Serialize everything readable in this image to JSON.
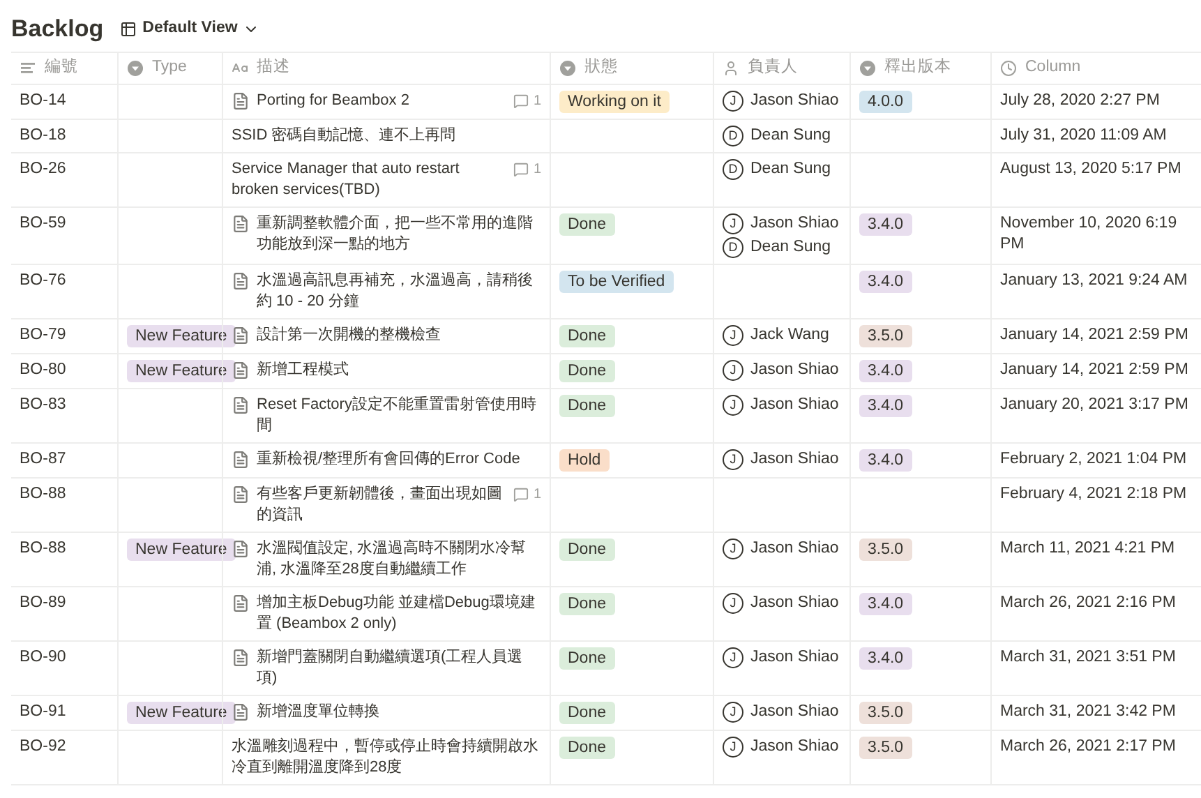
{
  "title": "Backlog",
  "view": {
    "label": "Default View"
  },
  "columns": [
    {
      "label": "編號",
      "kind": "text"
    },
    {
      "label": "Type",
      "kind": "select"
    },
    {
      "label": "描述",
      "kind": "title"
    },
    {
      "label": "狀態",
      "kind": "select"
    },
    {
      "label": "負責人",
      "kind": "person"
    },
    {
      "label": "釋出版本",
      "kind": "select"
    },
    {
      "label": "Column",
      "kind": "date"
    }
  ],
  "rows": [
    {
      "id": "BO-14",
      "type": null,
      "title": "Porting for Beambox 2",
      "page": true,
      "comments": "1",
      "status": {
        "label": "Working on it",
        "color": "#fdecc8"
      },
      "assignees": [
        {
          "initial": "J",
          "name": "Jason Shiao"
        }
      ],
      "version": {
        "label": "4.0.0",
        "color": "#d3e5ef"
      },
      "date": "July 28, 2020 2:27 PM"
    },
    {
      "id": "BO-18",
      "type": null,
      "title": "SSID 密碼自動記憶、連不上再問",
      "page": false,
      "comments": null,
      "status": null,
      "assignees": [
        {
          "initial": "D",
          "name": "Dean Sung"
        }
      ],
      "version": null,
      "date": "July 31, 2020 11:09 AM"
    },
    {
      "id": "BO-26",
      "type": null,
      "title": "Service Manager that auto restart broken services(TBD)",
      "page": false,
      "comments": "1",
      "status": null,
      "assignees": [
        {
          "initial": "D",
          "name": "Dean Sung"
        }
      ],
      "version": null,
      "date": "August 13, 2020 5:17 PM"
    },
    {
      "id": "BO-59",
      "type": null,
      "title": "重新調整軟體介面，把一些不常用的進階功能放到深一點的地方",
      "page": true,
      "comments": null,
      "status": {
        "label": "Done",
        "color": "#dbeddb"
      },
      "assignees": [
        {
          "initial": "J",
          "name": "Jason Shiao"
        },
        {
          "initial": "D",
          "name": "Dean Sung"
        }
      ],
      "version": {
        "label": "3.4.0",
        "color": "#e8deee"
      },
      "date": "November 10, 2020 6:19 PM"
    },
    {
      "id": "BO-76",
      "type": null,
      "title": "水溫過高訊息再補充，水溫過高，請稍後約 10 - 20 分鐘",
      "page": true,
      "comments": null,
      "status": {
        "label": "To be Verified",
        "color": "#d3e5ef"
      },
      "assignees": [],
      "version": {
        "label": "3.4.0",
        "color": "#e8deee"
      },
      "date": "January 13, 2021 9:24 AM"
    },
    {
      "id": "BO-79",
      "type": {
        "label": "New Feature",
        "color": "#e8deee"
      },
      "title": "設計第一次開機的整機檢查",
      "page": true,
      "comments": null,
      "status": {
        "label": "Done",
        "color": "#dbeddb"
      },
      "assignees": [
        {
          "initial": "J",
          "name": "Jack Wang"
        }
      ],
      "version": {
        "label": "3.5.0",
        "color": "#eee0da"
      },
      "date": "January 14, 2021 2:59 PM"
    },
    {
      "id": "BO-80",
      "type": {
        "label": "New Feature",
        "color": "#e8deee"
      },
      "title": "新增工程模式",
      "page": true,
      "comments": null,
      "status": {
        "label": "Done",
        "color": "#dbeddb"
      },
      "assignees": [
        {
          "initial": "J",
          "name": "Jason Shiao"
        }
      ],
      "version": {
        "label": "3.4.0",
        "color": "#e8deee"
      },
      "date": "January 14, 2021 2:59 PM"
    },
    {
      "id": "BO-83",
      "type": null,
      "title": "Reset Factory設定不能重置雷射管使用時間",
      "page": true,
      "comments": null,
      "status": {
        "label": "Done",
        "color": "#dbeddb"
      },
      "assignees": [
        {
          "initial": "J",
          "name": "Jason Shiao"
        }
      ],
      "version": {
        "label": "3.4.0",
        "color": "#e8deee"
      },
      "date": "January 20, 2021 3:17 PM"
    },
    {
      "id": "BO-87",
      "type": null,
      "title": "重新檢視/整理所有會回傳的Error Code",
      "page": true,
      "comments": null,
      "status": {
        "label": "Hold",
        "color": "#fadec9"
      },
      "assignees": [
        {
          "initial": "J",
          "name": "Jason Shiao"
        }
      ],
      "version": {
        "label": "3.4.0",
        "color": "#e8deee"
      },
      "date": "February 2, 2021 1:04 PM"
    },
    {
      "id": "BO-88",
      "type": null,
      "title": "有些客戶更新韌體後，畫面出現如圖的資訊",
      "page": true,
      "comments": "1",
      "status": null,
      "assignees": [],
      "version": null,
      "date": "February 4, 2021 2:18 PM"
    },
    {
      "id": "BO-88",
      "type": {
        "label": "New Feature",
        "color": "#e8deee"
      },
      "title": "水溫閥值設定, 水溫過高時不關閉水冷幫浦, 水溫降至28度自動繼續工作",
      "page": true,
      "comments": null,
      "status": {
        "label": "Done",
        "color": "#dbeddb"
      },
      "assignees": [
        {
          "initial": "J",
          "name": "Jason Shiao"
        }
      ],
      "version": {
        "label": "3.5.0",
        "color": "#eee0da"
      },
      "date": "March 11, 2021 4:21 PM"
    },
    {
      "id": "BO-89",
      "type": null,
      "title": "增加主板Debug功能 並建檔Debug環境建置 (Beambox 2 only)",
      "page": true,
      "comments": null,
      "status": {
        "label": "Done",
        "color": "#dbeddb"
      },
      "assignees": [
        {
          "initial": "J",
          "name": "Jason Shiao"
        }
      ],
      "version": {
        "label": "3.4.0",
        "color": "#e8deee"
      },
      "date": "March 26, 2021 2:16 PM"
    },
    {
      "id": "BO-90",
      "type": null,
      "title": "新增門蓋關閉自動繼續選項(工程人員選項)",
      "page": true,
      "comments": null,
      "status": {
        "label": "Done",
        "color": "#dbeddb"
      },
      "assignees": [
        {
          "initial": "J",
          "name": "Jason Shiao"
        }
      ],
      "version": {
        "label": "3.4.0",
        "color": "#e8deee"
      },
      "date": "March 31, 2021 3:51 PM"
    },
    {
      "id": "BO-91",
      "type": {
        "label": "New Feature",
        "color": "#e8deee"
      },
      "title": "新增溫度單位轉換",
      "page": true,
      "comments": null,
      "status": {
        "label": "Done",
        "color": "#dbeddb"
      },
      "assignees": [
        {
          "initial": "J",
          "name": "Jason Shiao"
        }
      ],
      "version": {
        "label": "3.5.0",
        "color": "#eee0da"
      },
      "date": "March 31, 2021 3:42 PM"
    },
    {
      "id": "BO-92",
      "type": null,
      "title": "水溫雕刻過程中，暫停或停止時會持續開啟水冷直到離開溫度降到28度",
      "page": false,
      "comments": null,
      "status": {
        "label": "Done",
        "color": "#dbeddb"
      },
      "assignees": [
        {
          "initial": "J",
          "name": "Jason Shiao"
        }
      ],
      "version": {
        "label": "3.5.0",
        "color": "#eee0da"
      },
      "date": "March 26, 2021 2:17 PM"
    }
  ]
}
